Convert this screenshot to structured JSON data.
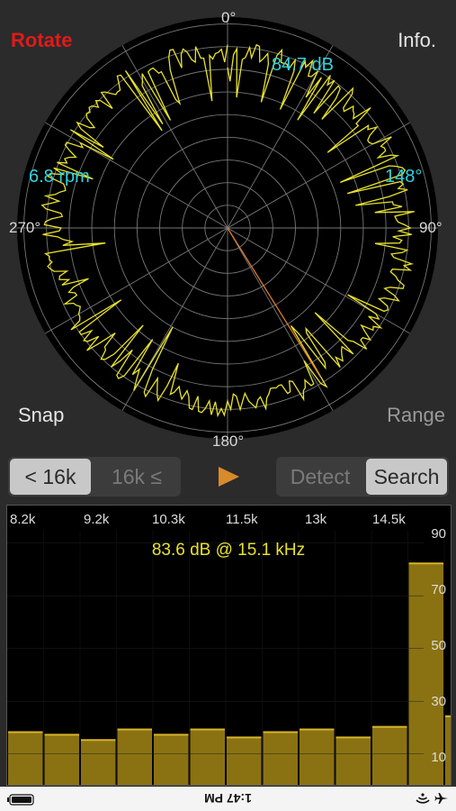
{
  "polar": {
    "angle_labels": {
      "top": "0°",
      "right": "90°",
      "bottom": "180°",
      "left": "270°"
    },
    "level_readout": "84.7 dB",
    "rpm_readout": "6.8 rpm",
    "angle_readout": "148°",
    "pointer_angle_deg": 148,
    "colors": {
      "trace": "#e8e22a",
      "pointer": "#e07a28",
      "readout": "#2fd3e0",
      "grid": "#777777"
    }
  },
  "buttons": {
    "rotate": "Rotate",
    "info": "Info.",
    "snap": "Snap",
    "range": "Range"
  },
  "freq_toggle": {
    "below": "< 16k",
    "above": "16k ≤",
    "selected": "below"
  },
  "mode_toggle": {
    "detect": "Detect",
    "search": "Search",
    "selected": "search"
  },
  "spectrum": {
    "freq_labels": [
      "8.2k",
      "9.2k",
      "10.3k",
      "11.5k",
      "13k",
      "14.5k"
    ],
    "db_labels": [
      "90",
      "70",
      "50",
      "30",
      "10"
    ],
    "peak_readout": "83.6 dB @ 15.1 kHz",
    "bar_levels_db": [
      20,
      19,
      17,
      21,
      19,
      21,
      18,
      20,
      21,
      18,
      22,
      84,
      26
    ],
    "colors": {
      "bar": "#8a7212",
      "bar_edge": "#d8b42a",
      "label": "#e8e22a"
    }
  },
  "status": {
    "time": "1:47 PM"
  }
}
